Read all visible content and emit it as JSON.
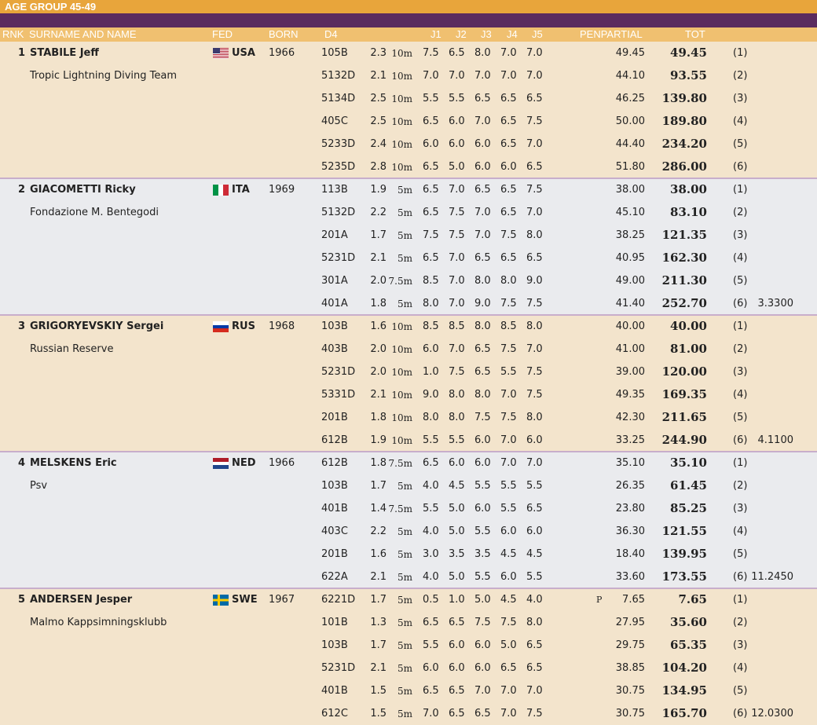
{
  "title": "AGE GROUP 45-49",
  "columns": {
    "rnk": "RNK",
    "name": "SURNAME AND NAME",
    "fed": "FED",
    "born": "BORN",
    "dive": "D4",
    "j1": "J1",
    "j2": "J2",
    "j3": "J3",
    "j4": "J4",
    "j5": "J5",
    "penpartial": "PENPARTIAL",
    "tot": "TOT"
  },
  "colors": {
    "title_bar": "#e8a53b",
    "purple_bar": "#5b2b5e",
    "header_bar": "#f0c070",
    "row_peach": "#f3e4cc",
    "row_grey": "#eaebee"
  },
  "athletes": [
    {
      "rank": "1",
      "name": "STABILE Jeff",
      "club": "Tropic Lightning Diving Team",
      "fed": "USA",
      "flag": "usa-flag-icon",
      "born": "1966",
      "extra": "",
      "dives": [
        {
          "code": "105B",
          "dd": "2.3",
          "height": "10m",
          "j": [
            "7.5",
            "6.5",
            "8.0",
            "7.0",
            "7.0"
          ],
          "pen": "",
          "partial": "49.45",
          "tot": "49.45",
          "pos": "(1)"
        },
        {
          "code": "5132D",
          "dd": "2.1",
          "height": "10m",
          "j": [
            "7.0",
            "7.0",
            "7.0",
            "7.0",
            "7.0"
          ],
          "pen": "",
          "partial": "44.10",
          "tot": "93.55",
          "pos": "(2)"
        },
        {
          "code": "5134D",
          "dd": "2.5",
          "height": "10m",
          "j": [
            "5.5",
            "5.5",
            "6.5",
            "6.5",
            "6.5"
          ],
          "pen": "",
          "partial": "46.25",
          "tot": "139.80",
          "pos": "(3)"
        },
        {
          "code": "405C",
          "dd": "2.5",
          "height": "10m",
          "j": [
            "6.5",
            "6.0",
            "7.0",
            "6.5",
            "7.5"
          ],
          "pen": "",
          "partial": "50.00",
          "tot": "189.80",
          "pos": "(4)"
        },
        {
          "code": "5233D",
          "dd": "2.4",
          "height": "10m",
          "j": [
            "6.0",
            "6.0",
            "6.0",
            "6.5",
            "7.0"
          ],
          "pen": "",
          "partial": "44.40",
          "tot": "234.20",
          "pos": "(5)"
        },
        {
          "code": "5235D",
          "dd": "2.8",
          "height": "10m",
          "j": [
            "6.5",
            "5.0",
            "6.0",
            "6.0",
            "6.5"
          ],
          "pen": "",
          "partial": "51.80",
          "tot": "286.00",
          "pos": "(6)"
        }
      ]
    },
    {
      "rank": "2",
      "name": "GIACOMETTI Ricky",
      "club": "Fondazione M. Bentegodi",
      "fed": "ITA",
      "flag": "italy-flag-icon",
      "born": "1969",
      "extra": "3.3300",
      "dives": [
        {
          "code": "113B",
          "dd": "1.9",
          "height": "5m",
          "j": [
            "6.5",
            "7.0",
            "6.5",
            "6.5",
            "7.5"
          ],
          "pen": "",
          "partial": "38.00",
          "tot": "38.00",
          "pos": "(1)"
        },
        {
          "code": "5132D",
          "dd": "2.2",
          "height": "5m",
          "j": [
            "6.5",
            "7.5",
            "7.0",
            "6.5",
            "7.0"
          ],
          "pen": "",
          "partial": "45.10",
          "tot": "83.10",
          "pos": "(2)"
        },
        {
          "code": "201A",
          "dd": "1.7",
          "height": "5m",
          "j": [
            "7.5",
            "7.5",
            "7.0",
            "7.5",
            "8.0"
          ],
          "pen": "",
          "partial": "38.25",
          "tot": "121.35",
          "pos": "(3)"
        },
        {
          "code": "5231D",
          "dd": "2.1",
          "height": "5m",
          "j": [
            "6.5",
            "7.0",
            "6.5",
            "6.5",
            "6.5"
          ],
          "pen": "",
          "partial": "40.95",
          "tot": "162.30",
          "pos": "(4)"
        },
        {
          "code": "301A",
          "dd": "2.0",
          "height": "7.5m",
          "j": [
            "8.5",
            "7.0",
            "8.0",
            "8.0",
            "9.0"
          ],
          "pen": "",
          "partial": "49.00",
          "tot": "211.30",
          "pos": "(5)"
        },
        {
          "code": "401A",
          "dd": "1.8",
          "height": "5m",
          "j": [
            "8.0",
            "7.0",
            "9.0",
            "7.5",
            "7.5"
          ],
          "pen": "",
          "partial": "41.40",
          "tot": "252.70",
          "pos": "(6)"
        }
      ]
    },
    {
      "rank": "3",
      "name": "GRIGORYEVSKIY Sergei",
      "club": "Russian Reserve",
      "fed": "RUS",
      "flag": "russia-flag-icon",
      "born": "1968",
      "extra": "4.1100",
      "dives": [
        {
          "code": "103B",
          "dd": "1.6",
          "height": "10m",
          "j": [
            "8.5",
            "8.5",
            "8.0",
            "8.5",
            "8.0"
          ],
          "pen": "",
          "partial": "40.00",
          "tot": "40.00",
          "pos": "(1)"
        },
        {
          "code": "403B",
          "dd": "2.0",
          "height": "10m",
          "j": [
            "6.0",
            "7.0",
            "6.5",
            "7.5",
            "7.0"
          ],
          "pen": "",
          "partial": "41.00",
          "tot": "81.00",
          "pos": "(2)"
        },
        {
          "code": "5231D",
          "dd": "2.0",
          "height": "10m",
          "j": [
            "1.0",
            "7.5",
            "6.5",
            "5.5",
            "7.5"
          ],
          "pen": "",
          "partial": "39.00",
          "tot": "120.00",
          "pos": "(3)"
        },
        {
          "code": "5331D",
          "dd": "2.1",
          "height": "10m",
          "j": [
            "9.0",
            "8.0",
            "8.0",
            "7.0",
            "7.5"
          ],
          "pen": "",
          "partial": "49.35",
          "tot": "169.35",
          "pos": "(4)"
        },
        {
          "code": "201B",
          "dd": "1.8",
          "height": "10m",
          "j": [
            "8.0",
            "8.0",
            "7.5",
            "7.5",
            "8.0"
          ],
          "pen": "",
          "partial": "42.30",
          "tot": "211.65",
          "pos": "(5)"
        },
        {
          "code": "612B",
          "dd": "1.9",
          "height": "10m",
          "j": [
            "5.5",
            "5.5",
            "6.0",
            "7.0",
            "6.0"
          ],
          "pen": "",
          "partial": "33.25",
          "tot": "244.90",
          "pos": "(6)"
        }
      ]
    },
    {
      "rank": "4",
      "name": "MELSKENS Eric",
      "club": "Psv",
      "fed": "NED",
      "flag": "netherlands-flag-icon",
      "born": "1966",
      "extra": "11.2450",
      "dives": [
        {
          "code": "612B",
          "dd": "1.8",
          "height": "7.5m",
          "j": [
            "6.5",
            "6.0",
            "6.0",
            "7.0",
            "7.0"
          ],
          "pen": "",
          "partial": "35.10",
          "tot": "35.10",
          "pos": "(1)"
        },
        {
          "code": "103B",
          "dd": "1.7",
          "height": "5m",
          "j": [
            "4.0",
            "4.5",
            "5.5",
            "5.5",
            "5.5"
          ],
          "pen": "",
          "partial": "26.35",
          "tot": "61.45",
          "pos": "(2)"
        },
        {
          "code": "401B",
          "dd": "1.4",
          "height": "7.5m",
          "j": [
            "5.5",
            "5.0",
            "6.0",
            "5.5",
            "6.5"
          ],
          "pen": "",
          "partial": "23.80",
          "tot": "85.25",
          "pos": "(3)"
        },
        {
          "code": "403C",
          "dd": "2.2",
          "height": "5m",
          "j": [
            "4.0",
            "5.0",
            "5.5",
            "6.0",
            "6.0"
          ],
          "pen": "",
          "partial": "36.30",
          "tot": "121.55",
          "pos": "(4)"
        },
        {
          "code": "201B",
          "dd": "1.6",
          "height": "5m",
          "j": [
            "3.0",
            "3.5",
            "3.5",
            "4.5",
            "4.5"
          ],
          "pen": "",
          "partial": "18.40",
          "tot": "139.95",
          "pos": "(5)"
        },
        {
          "code": "622A",
          "dd": "2.1",
          "height": "5m",
          "j": [
            "4.0",
            "5.0",
            "5.5",
            "6.0",
            "5.5"
          ],
          "pen": "",
          "partial": "33.60",
          "tot": "173.55",
          "pos": "(6)"
        }
      ]
    },
    {
      "rank": "5",
      "name": "ANDERSEN Jesper",
      "club": "Malmo Kappsimningsklubb",
      "fed": "SWE",
      "flag": "sweden-flag-icon",
      "born": "1967",
      "extra": "12.0300",
      "dives": [
        {
          "code": "6221D",
          "dd": "1.7",
          "height": "5m",
          "j": [
            "0.5",
            "1.0",
            "5.0",
            "4.5",
            "4.0"
          ],
          "pen": "P",
          "partial": "7.65",
          "tot": "7.65",
          "pos": "(1)"
        },
        {
          "code": "101B",
          "dd": "1.3",
          "height": "5m",
          "j": [
            "6.5",
            "6.5",
            "7.5",
            "7.5",
            "8.0"
          ],
          "pen": "",
          "partial": "27.95",
          "tot": "35.60",
          "pos": "(2)"
        },
        {
          "code": "103B",
          "dd": "1.7",
          "height": "5m",
          "j": [
            "5.5",
            "6.0",
            "6.0",
            "5.0",
            "6.5"
          ],
          "pen": "",
          "partial": "29.75",
          "tot": "65.35",
          "pos": "(3)"
        },
        {
          "code": "5231D",
          "dd": "2.1",
          "height": "5m",
          "j": [
            "6.0",
            "6.0",
            "6.0",
            "6.5",
            "6.5"
          ],
          "pen": "",
          "partial": "38.85",
          "tot": "104.20",
          "pos": "(4)"
        },
        {
          "code": "401B",
          "dd": "1.5",
          "height": "5m",
          "j": [
            "6.5",
            "6.5",
            "7.0",
            "7.0",
            "7.0"
          ],
          "pen": "",
          "partial": "30.75",
          "tot": "134.95",
          "pos": "(5)"
        },
        {
          "code": "612C",
          "dd": "1.5",
          "height": "5m",
          "j": [
            "7.0",
            "6.5",
            "6.5",
            "7.0",
            "7.5"
          ],
          "pen": "",
          "partial": "30.75",
          "tot": "165.70",
          "pos": "(6)"
        }
      ]
    }
  ]
}
